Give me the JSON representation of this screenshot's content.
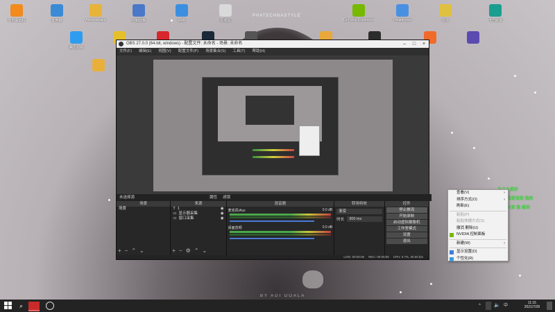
{
  "desktop": {
    "icons": [
      {
        "label": "向日葵远程",
        "color": "#f28a1c"
      },
      {
        "label": "此电脑",
        "color": "#3b8ad6"
      },
      {
        "label": "Administrator",
        "color": "#e8b33a"
      },
      {
        "label": "控制面板",
        "color": "#4a78c8"
      },
      {
        "label": "网络",
        "color": "#3c8fe0"
      },
      {
        "label": "回收站",
        "color": "#d9d9d9"
      },
      {
        "label": "GeForce Experience",
        "color": "#76b900"
      },
      {
        "label": "Ninjadevice",
        "color": "#4a90e2"
      },
      {
        "label": "文件",
        "color": "#e0c040"
      },
      {
        "label": "卡巴斯基",
        "color": "#1a9e8f"
      },
      {
        "label": "腾讯视频",
        "color": "#2e9df0"
      },
      {
        "label": "",
        "color": "#e5c02a"
      },
      {
        "label": "网易云音乐",
        "color": "#d7262c"
      },
      {
        "label": "Steam",
        "color": "#1b2838"
      },
      {
        "label": "",
        "color": "#555"
      },
      {
        "label": "",
        "color": "#e8a83a"
      },
      {
        "label": "",
        "color": "#2c2c2c"
      },
      {
        "label": "",
        "color": "#f06a2a"
      },
      {
        "label": "",
        "color": "#5b4ab0"
      },
      {
        "label": "",
        "color": "#e8b03a"
      }
    ],
    "watermark": "PHATECHNASTYLE",
    "signature": "BY ADI DOALA"
  },
  "obs": {
    "title": "OBS 27.0.0 (64-bit, windows) - 配置文件: 未命名 - 场景: 未命名",
    "menu": [
      "文件(F)",
      "编辑(E)",
      "视图(V)",
      "配置文件(P)",
      "场景集合(S)",
      "工具(T)",
      "帮助(H)"
    ],
    "status_strip": {
      "label": "未选择源",
      "props": "属性",
      "filters": "滤镜"
    },
    "docks": {
      "scenes": {
        "header": "场景",
        "items": [
          "场景"
        ]
      },
      "sources": {
        "header": "来源",
        "items": [
          "1",
          "显示器采集",
          "窗口采集"
        ]
      },
      "mixer": {
        "header": "混音器",
        "tracks": [
          {
            "name": "麦克风/Aux",
            "db": "0.0 dB"
          },
          {
            "name": "桌面音频",
            "db": "0.0 dB"
          }
        ]
      },
      "transitions": {
        "header": "转场特效",
        "type": "渐变",
        "duration_label": "时长",
        "duration": "300 ms"
      },
      "controls": {
        "header": "控件",
        "buttons": [
          "停止推流",
          "开始录制",
          "启动虚拟摄像机",
          "工作室模式",
          "设置",
          "退出"
        ]
      }
    },
    "statusbar": {
      "live": "LIVE: 00:00:00",
      "rec": "REC: 00:00:00",
      "cpu": "CPU: 0.7%, 30.00 fps"
    }
  },
  "context_menu": {
    "items": [
      {
        "label": "查看(V)",
        "disabled": false,
        "submenu": true
      },
      {
        "label": "排序方式(O)",
        "disabled": false,
        "submenu": true
      },
      {
        "label": "刷新(E)",
        "disabled": false,
        "submenu": false
      },
      {
        "label": "粘贴(P)",
        "disabled": true,
        "submenu": false
      },
      {
        "label": "粘贴快捷方式(S)",
        "disabled": true,
        "submenu": false
      },
      {
        "label": "撤消 删除(U)",
        "disabled": false,
        "submenu": false
      },
      {
        "label": "NVIDIA 控制面板",
        "disabled": false,
        "submenu": false
      },
      {
        "label": "新建(W)",
        "disabled": false,
        "submenu": true
      },
      {
        "label": "显示设置(D)",
        "disabled": false,
        "submenu": false
      },
      {
        "label": "个性化(R)",
        "disabled": false,
        "submenu": false
      }
    ]
  },
  "overlay_text": {
    "green_1": "为了大家好",
    "green_2": "方法 就是找到 我的",
    "green_3": "为了 大家 能 看的"
  },
  "taskbar": {
    "time": "11:15",
    "date": "2021/7/28",
    "lang": "中"
  }
}
